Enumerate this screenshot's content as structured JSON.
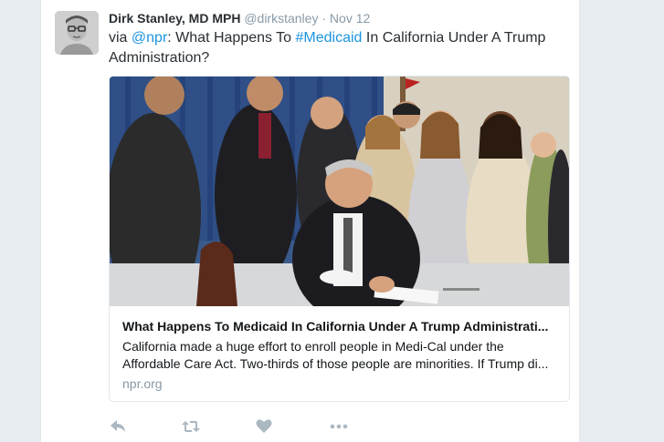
{
  "tweet": {
    "author_name": "Dirk Stanley, MD MPH",
    "handle": "@dirkstanley",
    "separator": "·",
    "time": "Nov 12",
    "text_prefix": "via",
    "mention": "@npr",
    "text_mid": ": What Happens To",
    "hashtag": "#Medicaid",
    "text_suffix": "In California Under A Trump Administration?"
  },
  "card": {
    "image_icon": "photo-bill-signing",
    "title": "What Happens To Medicaid In California Under A Trump Administrati...",
    "description": "California made a huge effort to enroll people in Medi-Cal under the Affordable Care Act. Two-thirds of those people are minorities. If Trump di...",
    "domain": "npr.org"
  },
  "actions": {
    "icons": [
      "reply-icon",
      "retweet-icon",
      "like-icon",
      "more-icon"
    ],
    "icon_color": "#aab8c2"
  },
  "colors": {
    "link": "#1b95e0",
    "background": "#e6ecf0"
  }
}
